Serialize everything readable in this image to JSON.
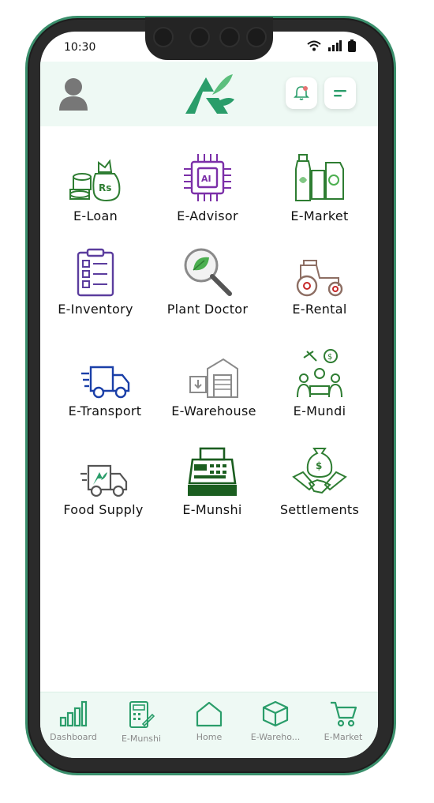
{
  "status": {
    "time": "10:30"
  },
  "grid": [
    {
      "label": "E-Loan"
    },
    {
      "label": "E-Advisor"
    },
    {
      "label": "E-Market"
    },
    {
      "label": "E-Inventory"
    },
    {
      "label": "Plant Doctor"
    },
    {
      "label": "E-Rental"
    },
    {
      "label": "E-Transport"
    },
    {
      "label": "E-Warehouse"
    },
    {
      "label": "E-Mundi"
    },
    {
      "label": "Food Supply"
    },
    {
      "label": "E-Munshi"
    },
    {
      "label": "Settlements"
    }
  ],
  "icon_text": {
    "loan_currency": "Rs",
    "advisor_chip": "AI"
  },
  "bottom_nav": [
    {
      "label": "Dashboard"
    },
    {
      "label": "E-Munshi"
    },
    {
      "label": "Home"
    },
    {
      "label": "E-Wareho..."
    },
    {
      "label": "E-Market"
    }
  ],
  "colors": {
    "brand_green": "#2a9d6a",
    "icon_green": "#2e7d32",
    "icon_purple": "#7b2fa8",
    "icon_blue": "#1a3fa8"
  }
}
